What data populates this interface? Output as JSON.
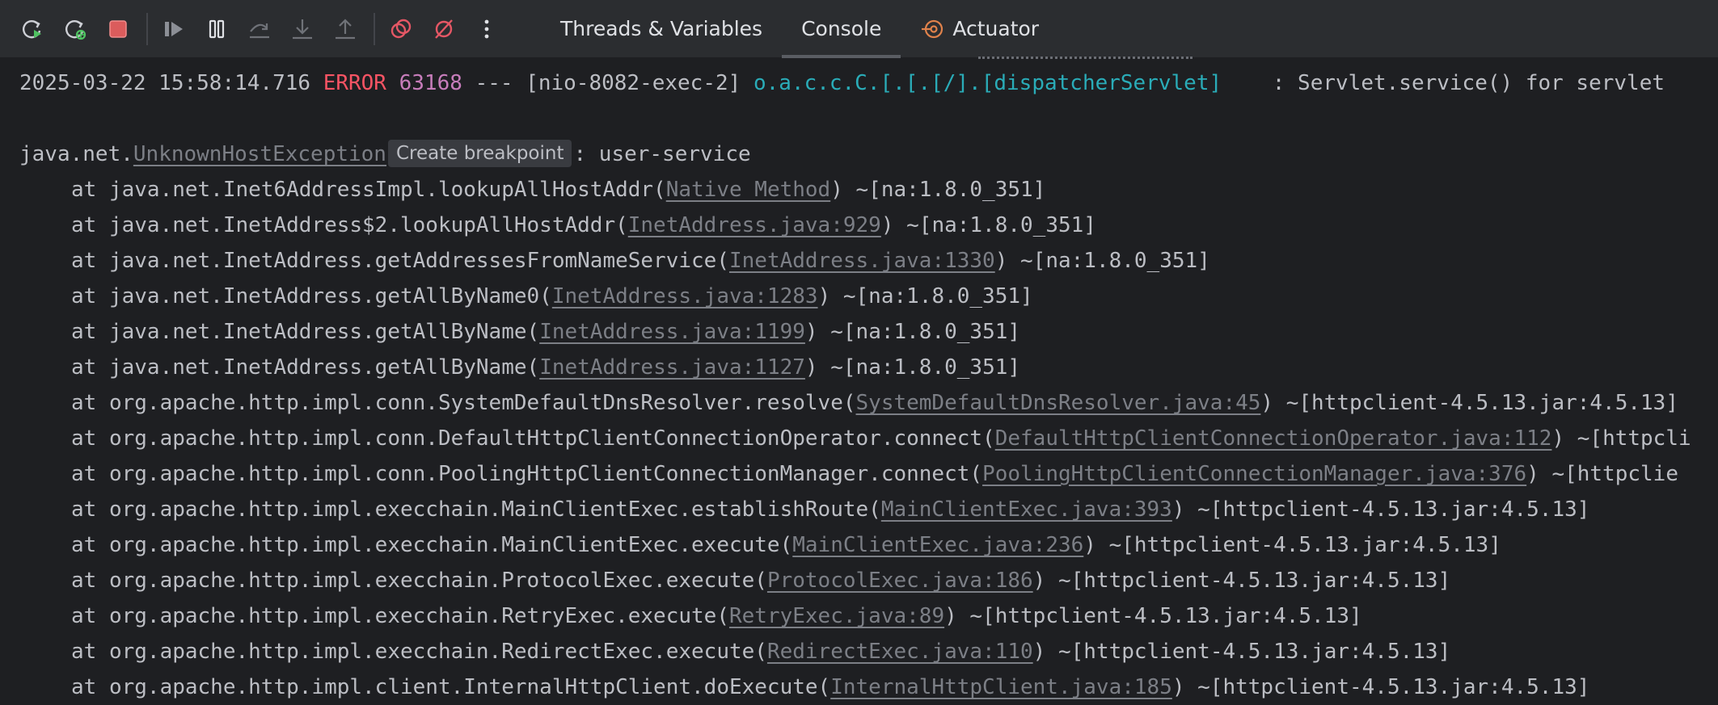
{
  "toolbar": {
    "buttons": [
      {
        "icon": "rerun-icon",
        "color": "#4fc361"
      },
      {
        "icon": "rerun-debug-icon",
        "color": "#4fc361"
      },
      {
        "icon": "stop-icon",
        "color": "#e55765"
      },
      {
        "icon": "resume-icon",
        "color": "#8c8f96"
      },
      {
        "icon": "pause-icon",
        "color": "#dfe1e5"
      },
      {
        "icon": "step-over-icon",
        "color": "#6f7278"
      },
      {
        "icon": "step-into-icon",
        "color": "#6f7278"
      },
      {
        "icon": "step-out-icon",
        "color": "#6f7278"
      },
      {
        "icon": "view-breakpoints-icon",
        "color": "#e55765"
      },
      {
        "icon": "mute-breakpoints-icon",
        "color": "#e55765"
      },
      {
        "icon": "more-options-icon",
        "color": "#dfe1e5"
      }
    ],
    "tabs": [
      {
        "label": "Threads & Variables",
        "active": false
      },
      {
        "label": "Console",
        "active": true
      },
      {
        "label": "Actuator",
        "active": false,
        "icon": "actuator-icon"
      }
    ]
  },
  "console": {
    "log": {
      "timestamp": "2025-03-22 15:58:14.716",
      "level": "ERROR",
      "pid": "63168",
      "separator": "---",
      "thread": "[nio-8082-exec-2]",
      "logger": "o.a.c.c.C.[.[.[/].[dispatcherServlet]",
      "message": "    : Servlet.service() for servlet"
    },
    "exception": {
      "package": "java.net.",
      "class": "UnknownHostException",
      "breakpoint_hint": "Create breakpoint",
      "message": ": user-service"
    },
    "stack": [
      {
        "method": "at java.net.Inet6AddressImpl.lookupAllHostAddr(",
        "source": "Native Method",
        "suffix": ") ~[na:1.8.0_351]"
      },
      {
        "method": "at java.net.InetAddress$2.lookupAllHostAddr(",
        "source": "InetAddress.java:929",
        "suffix": ") ~[na:1.8.0_351]"
      },
      {
        "method": "at java.net.InetAddress.getAddressesFromNameService(",
        "source": "InetAddress.java:1330",
        "suffix": ") ~[na:1.8.0_351]"
      },
      {
        "method": "at java.net.InetAddress.getAllByName0(",
        "source": "InetAddress.java:1283",
        "suffix": ") ~[na:1.8.0_351]"
      },
      {
        "method": "at java.net.InetAddress.getAllByName(",
        "source": "InetAddress.java:1199",
        "suffix": ") ~[na:1.8.0_351]"
      },
      {
        "method": "at java.net.InetAddress.getAllByName(",
        "source": "InetAddress.java:1127",
        "suffix": ") ~[na:1.8.0_351]"
      },
      {
        "method": "at org.apache.http.impl.conn.SystemDefaultDnsResolver.resolve(",
        "source": "SystemDefaultDnsResolver.java:45",
        "suffix": ") ~[httpclient-4.5.13.jar:4.5.13]"
      },
      {
        "method": "at org.apache.http.impl.conn.DefaultHttpClientConnectionOperator.connect(",
        "source": "DefaultHttpClientConnectionOperator.java:112",
        "suffix": ") ~[httpcli"
      },
      {
        "method": "at org.apache.http.impl.conn.PoolingHttpClientConnectionManager.connect(",
        "source": "PoolingHttpClientConnectionManager.java:376",
        "suffix": ") ~[httpclie"
      },
      {
        "method": "at org.apache.http.impl.execchain.MainClientExec.establishRoute(",
        "source": "MainClientExec.java:393",
        "suffix": ") ~[httpclient-4.5.13.jar:4.5.13]"
      },
      {
        "method": "at org.apache.http.impl.execchain.MainClientExec.execute(",
        "source": "MainClientExec.java:236",
        "suffix": ") ~[httpclient-4.5.13.jar:4.5.13]"
      },
      {
        "method": "at org.apache.http.impl.execchain.ProtocolExec.execute(",
        "source": "ProtocolExec.java:186",
        "suffix": ") ~[httpclient-4.5.13.jar:4.5.13]"
      },
      {
        "method": "at org.apache.http.impl.execchain.RetryExec.execute(",
        "source": "RetryExec.java:89",
        "suffix": ") ~[httpclient-4.5.13.jar:4.5.13]"
      },
      {
        "method": "at org.apache.http.impl.execchain.RedirectExec.execute(",
        "source": "RedirectExec.java:110",
        "suffix": ") ~[httpclient-4.5.13.jar:4.5.13]"
      },
      {
        "method": "at org.apache.http.impl.client.InternalHttpClient.doExecute(",
        "source": "InternalHttpClient.java:185",
        "suffix": ") ~[httpclient-4.5.13.jar:4.5.13]"
      }
    ]
  }
}
